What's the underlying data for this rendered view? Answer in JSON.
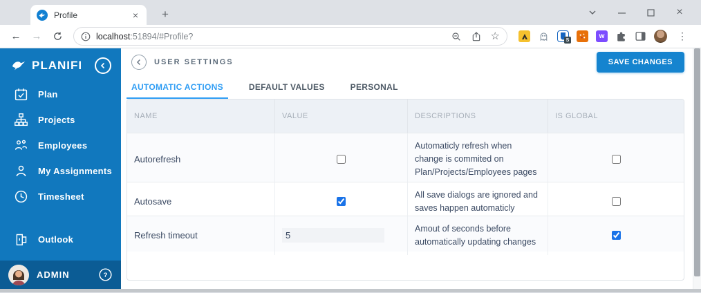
{
  "browser": {
    "tab_title": "Profile",
    "url_host": "localhost",
    "url_path": ":51894/#Profile?"
  },
  "sidebar": {
    "brand": "PLANIFI",
    "items": [
      {
        "label": "Plan",
        "icon": "calendar-check-icon"
      },
      {
        "label": "Projects",
        "icon": "org-chart-icon"
      },
      {
        "label": "Employees",
        "icon": "people-icon"
      },
      {
        "label": "My Assignments",
        "icon": "person-icon"
      },
      {
        "label": "Timesheet",
        "icon": "clock-icon"
      },
      {
        "label": "Outlook",
        "icon": "outlook-icon"
      }
    ],
    "user": {
      "name": "ADMIN"
    }
  },
  "settings": {
    "title": "USER SETTINGS",
    "save_button": "SAVE CHANGES",
    "tabs": [
      {
        "label": "AUTOMATIC ACTIONS",
        "active": true
      },
      {
        "label": "DEFAULT VALUES",
        "active": false
      },
      {
        "label": "PERSONAL",
        "active": false
      }
    ],
    "table": {
      "columns": [
        "NAME",
        "VALUE",
        "DESCRIPTIONS",
        "IS GLOBAL"
      ],
      "rows": [
        {
          "name": "Autorefresh",
          "value_type": "checkbox",
          "value_checked": false,
          "description": "Automaticly refresh when change is commited on Plan/Projects/Employees pages",
          "is_global": false
        },
        {
          "name": "Autosave",
          "value_type": "checkbox",
          "value_checked": true,
          "description": "All save dialogs are ignored and saves happen automaticly",
          "is_global": false
        },
        {
          "name": "Refresh timeout",
          "value_type": "text",
          "value": "5",
          "description": "Amout of seconds before automatically updating changes",
          "is_global": true
        }
      ]
    }
  },
  "colors": {
    "sidebar_blue": "#1178be",
    "sidebar_dark_blue": "#0b5c95",
    "accent_blue": "#1584cf",
    "active_tab_blue": "#2f9df4",
    "checkbox_blue": "#1a73e8",
    "chrome_bg": "#dee1e6"
  }
}
